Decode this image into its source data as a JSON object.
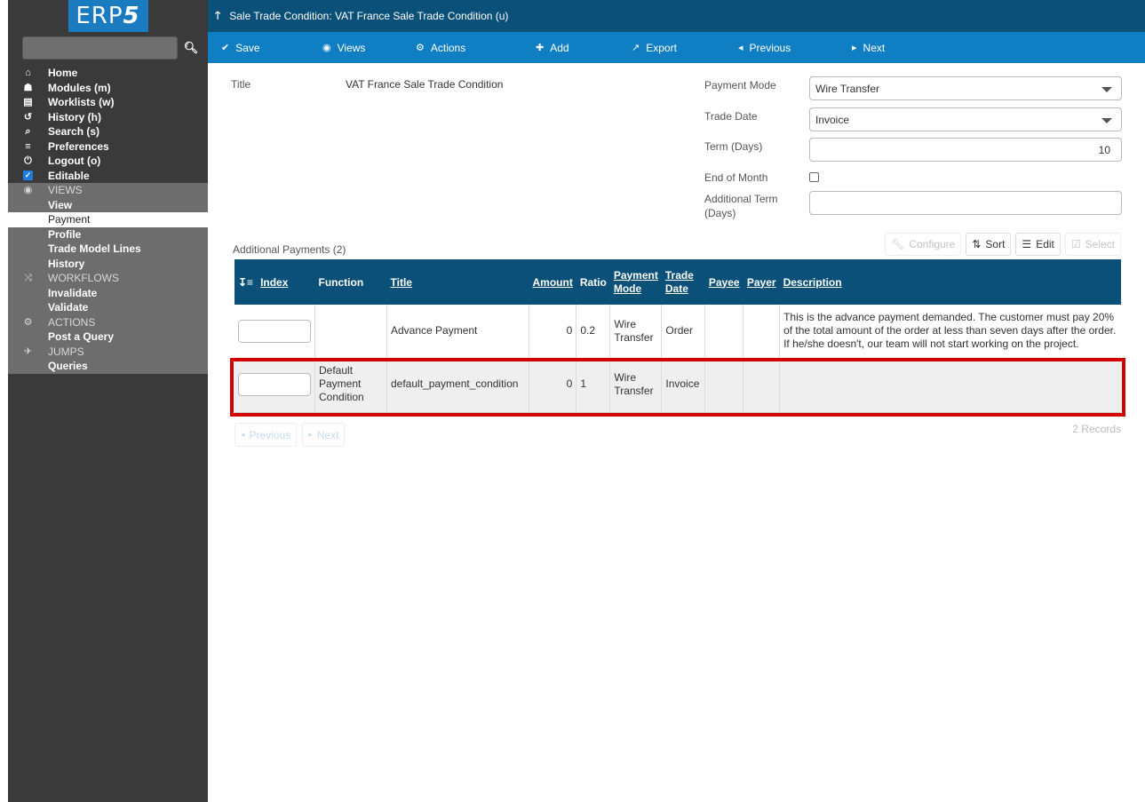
{
  "app": {
    "logo_text": "ERP",
    "logo_suffix": "5"
  },
  "sidebar": {
    "search_placeholder": "",
    "items": [
      {
        "label": "Home",
        "icon": "home-icon"
      },
      {
        "label": "Modules (m)",
        "icon": "puzzle-icon"
      },
      {
        "label": "Worklists (w)",
        "icon": "inbox-icon"
      },
      {
        "label": "History (h)",
        "icon": "history-icon"
      },
      {
        "label": "Search (s)",
        "icon": "search-icon"
      },
      {
        "label": "Preferences",
        "icon": "sliders-icon"
      },
      {
        "label": "Logout (o)",
        "icon": "power-icon"
      },
      {
        "label": "Editable",
        "icon": "checkbox-checked-icon",
        "checked": true
      }
    ],
    "sections": [
      {
        "title": "VIEWS",
        "icon": "eye-icon",
        "items": [
          "View",
          "Payment",
          "Profile",
          "Trade Model Lines",
          "History"
        ],
        "active": "Payment"
      },
      {
        "title": "WORKFLOWS",
        "icon": "shuffle-icon",
        "items": [
          "Invalidate",
          "Validate"
        ]
      },
      {
        "title": "ACTIONS",
        "icon": "cogs-icon",
        "items": [
          "Post a Query"
        ]
      },
      {
        "title": "JUMPS",
        "icon": "plane-icon",
        "items": [
          "Queries"
        ]
      }
    ]
  },
  "header": {
    "title": "Sale Trade Condition: VAT France Sale Trade Condition (u)"
  },
  "toolbar": {
    "save": "Save",
    "views": "Views",
    "actions": "Actions",
    "add": "Add",
    "export": "Export",
    "previous": "Previous",
    "next": "Next"
  },
  "form": {
    "title_label": "Title",
    "title_value": "VAT France Sale Trade Condition",
    "payment_mode_label": "Payment Mode",
    "payment_mode_value": "Wire Transfer",
    "trade_date_label": "Trade Date",
    "trade_date_value": "Invoice",
    "term_label": "Term (Days)",
    "term_value": "10",
    "end_of_month_label": "End of Month",
    "end_of_month_checked": false,
    "additional_term_label_1": "Additional Term",
    "additional_term_label_2": "(Days)",
    "additional_term_value": ""
  },
  "listbox": {
    "title": "Additional Payments (2)",
    "actions": {
      "configure": "Configure",
      "sort": "Sort",
      "edit": "Edit",
      "select": "Select"
    },
    "columns": [
      "Index",
      "Function",
      "Title",
      "Amount",
      "Ratio",
      "Payment Mode",
      "Trade Date",
      "Payee",
      "Payer",
      "Description"
    ],
    "columns_split": {
      "payment_mode_1": "Payment",
      "payment_mode_2": "Mode",
      "trade_date_1": "Trade",
      "trade_date_2": "Date"
    },
    "rows": [
      {
        "index": "",
        "function": "",
        "title": "Advance Payment",
        "amount": "0",
        "ratio": "0.2",
        "payment_mode_1": "Wire",
        "payment_mode_2": "Transfer",
        "trade_date": "Order",
        "payee": "",
        "payer": "",
        "description": "This is the advance payment demanded. The customer must pay 20% of the total amount of the order at less than seven days after the order. If he/she doesn't, our team will not start working on the project."
      },
      {
        "index": "",
        "function_1": "Default",
        "function_2": "Payment",
        "function_3": "Condition",
        "title": "default_payment_condition",
        "amount": "0",
        "ratio": "1",
        "payment_mode_1": "Wire",
        "payment_mode_2": "Transfer",
        "trade_date": "Invoice",
        "payee": "",
        "payer": "",
        "description": "",
        "highlighted": true
      }
    ],
    "pager": {
      "previous": "Previous",
      "next": "Next",
      "records": "2 Records"
    }
  },
  "colors": {
    "header_dark": "#0a5078",
    "toolbar_blue": "#107ec3",
    "sidebar_dark": "#3a3a3a",
    "sidebar_section": "#6d6d6d",
    "highlight_red": "#d40000",
    "logo_blue": "#1a7bc1"
  }
}
